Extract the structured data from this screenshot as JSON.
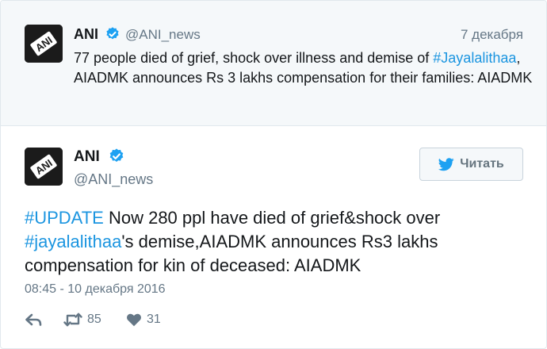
{
  "quoted_tweet": {
    "name": "ANI",
    "handle": "@ANI_news",
    "date": "7 декабря",
    "text_before": "77 people died of grief, shock over illness and demise of ",
    "hashtag": "#Jayalalithaa",
    "text_after": ", AIADMK announces Rs 3 lakhs compensation for their families: AIADMK",
    "avatar_icon": "ani-logo-icon",
    "verified_icon": "verified-badge-icon"
  },
  "main_tweet": {
    "name": "ANI",
    "handle": "@ANI_news",
    "follow_label": "Читать",
    "hashtag1": "#UPDATE",
    "text_part1": " Now 280 ppl have died of grief&shock over ",
    "hashtag2": "#jayalalithaa",
    "text_part2": "'s demise,AIADMK announces Rs3 lakhs compensation for kin of deceased: AIADMK",
    "timestamp": "08:45 - 10 декабря 2016",
    "retweets": "85",
    "likes": "31",
    "avatar_icon": "ani-logo-icon",
    "verified_icon": "verified-badge-icon"
  },
  "colors": {
    "link": "#1b95e0",
    "verified": "#1da1f2",
    "muted": "#657786",
    "quoted_background": "#f5f8fa",
    "avatar_background": "#1b1b1b"
  }
}
